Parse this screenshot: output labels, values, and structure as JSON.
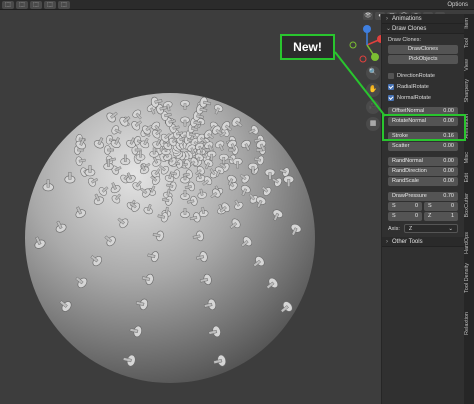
{
  "app": {
    "options_label": "Options"
  },
  "toolbar": {
    "buttons": [
      "⬚",
      "⬚",
      "⬚",
      "⬚",
      "⬚"
    ]
  },
  "viewport_header": {
    "icons": [
      "👁",
      "◐",
      "▢",
      "◯",
      "◉",
      "●",
      "▾"
    ]
  },
  "gizmo": {
    "axes": [
      {
        "label": "X",
        "color": "#e0413e"
      },
      {
        "label": "Y",
        "color": "#7bbf32"
      },
      {
        "label": "Z",
        "color": "#3f7fe0"
      }
    ]
  },
  "nav_buttons": [
    "🔍",
    "✋",
    "🎥",
    "▦"
  ],
  "callout": {
    "text": "New!",
    "color": "#29c52e"
  },
  "panel": {
    "animations_header": "Animations",
    "draw_clones_header": "Draw Clones",
    "draw_clones_label": "Draw Clones:",
    "drawclones_button": "DrawClones",
    "pickobjects_button": "PickObjects",
    "checkboxes": [
      {
        "label": "DirectionRotate",
        "checked": false
      },
      {
        "label": "RadialRotate",
        "checked": true
      },
      {
        "label": "NormalRotate",
        "checked": true
      }
    ],
    "fields_new": [
      {
        "label": "OffsetNormal",
        "value": "0.00"
      },
      {
        "label": "RotateNormal",
        "value": "0.00"
      }
    ],
    "fields_a": [
      {
        "label": "Stroke",
        "value": "0.16"
      },
      {
        "label": "Scatter",
        "value": "0.00"
      }
    ],
    "fields_b": [
      {
        "label": "RandNormal",
        "value": "0.00"
      },
      {
        "label": "RandDirection",
        "value": "0.00"
      },
      {
        "label": "RandScale",
        "value": "0.00"
      }
    ],
    "fields_c": [
      {
        "label": "DrawPressure",
        "value": "0.70"
      }
    ],
    "s_pair_1": [
      {
        "label": "S",
        "value": "0"
      },
      {
        "label": "S",
        "value": "0"
      }
    ],
    "s_pair_2": [
      {
        "label": "S",
        "value": "0"
      },
      {
        "label": "Z",
        "value": "1"
      }
    ],
    "axis_label": "Axis:",
    "axis_value": "Z",
    "other_tools_header": "Other Tools"
  },
  "side_tabs": [
    "Item",
    "Tool",
    "View",
    "Sharpeny",
    "Animation",
    "Misc",
    "Edit",
    "BoxCutter",
    "HardOps",
    "Tool Density",
    "Relaxtion"
  ]
}
